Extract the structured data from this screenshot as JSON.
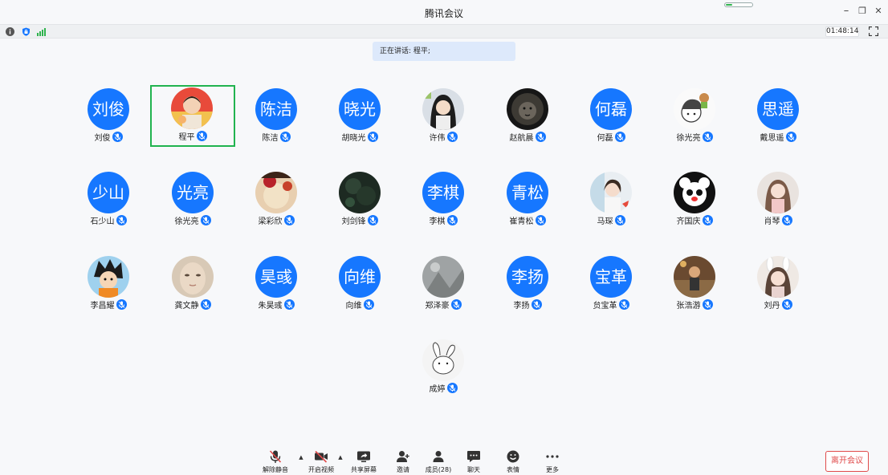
{
  "window": {
    "title": "腾讯会议",
    "network_level": 0.25,
    "minimize": "–",
    "restore": "❐",
    "close": "✕"
  },
  "status": {
    "timer": "01:48:14"
  },
  "banner": {
    "speaking_text": "正在讲话: 程平;"
  },
  "colors": {
    "accent": "#1677ff",
    "active_border": "#21b34f",
    "leave": "#e04b4b"
  },
  "participants": [
    {
      "name": "刘俊",
      "avatar_text": "刘俊"
    },
    {
      "name": "程平",
      "avatar_photo": "photo-child-red",
      "active": true
    },
    {
      "name": "陈洁",
      "avatar_text": "陈洁"
    },
    {
      "name": "胡晓光",
      "avatar_text": "晓光"
    },
    {
      "name": "许伟",
      "avatar_photo": "photo-girl"
    },
    {
      "name": "赵航晨",
      "avatar_photo": "photo-lion"
    },
    {
      "name": "何磊",
      "avatar_text": "何磊"
    },
    {
      "name": "徐光亮",
      "avatar_photo": "photo-cartoon"
    },
    {
      "name": "戴思遥",
      "avatar_text": "思遥"
    },
    {
      "name": "石少山",
      "avatar_text": "少山"
    },
    {
      "name": "徐光亮",
      "avatar_text": "光亮"
    },
    {
      "name": "梁彩欣",
      "avatar_photo": "photo-food"
    },
    {
      "name": "刘剑锋",
      "avatar_photo": "photo-dark-green"
    },
    {
      "name": "李棋",
      "avatar_text": "李棋"
    },
    {
      "name": "崔青松",
      "avatar_text": "青松"
    },
    {
      "name": "马琛",
      "avatar_photo": "photo-girl-light"
    },
    {
      "name": "齐国庆",
      "avatar_photo": "photo-panda"
    },
    {
      "name": "肖琴",
      "avatar_photo": "photo-girl-pink"
    },
    {
      "name": "李昌耀",
      "avatar_photo": "photo-anime"
    },
    {
      "name": "龚文静",
      "avatar_photo": "photo-face"
    },
    {
      "name": "朱昊彧",
      "avatar_text": "昊彧"
    },
    {
      "name": "向维",
      "avatar_text": "向维"
    },
    {
      "name": "郑泽豪",
      "avatar_photo": "photo-gray"
    },
    {
      "name": "李扬",
      "avatar_text": "李扬"
    },
    {
      "name": "贠宝革",
      "avatar_text": "宝革"
    },
    {
      "name": "张浩游",
      "avatar_photo": "photo-brown"
    },
    {
      "name": "刘丹",
      "avatar_photo": "photo-girl-bunny"
    },
    {
      "name": "成婷",
      "avatar_photo": "photo-rabbit-sketch"
    }
  ],
  "toolbar": {
    "unmute": "解除静音",
    "start_video": "开启视频",
    "share_screen": "共享屏幕",
    "invite": "邀请",
    "members": "成员(28)",
    "chat": "聊天",
    "reactions": "表情",
    "more": "更多",
    "leave": "离开会议",
    "caret": "▲"
  }
}
